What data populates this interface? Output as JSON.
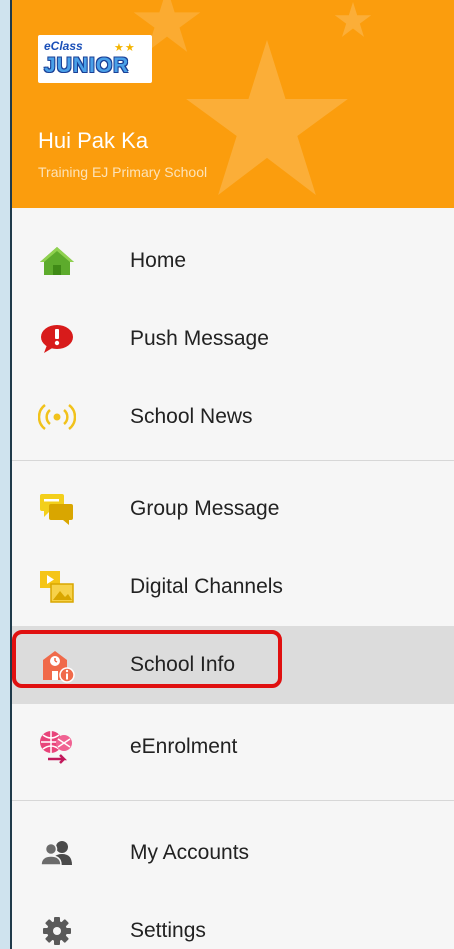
{
  "drawer": {
    "logo": {
      "eclass_text": "eClass",
      "junior_text": "JUNIOR"
    },
    "user_name": "Hui Pak Ka",
    "school_name": "Training EJ Primary School",
    "colors": {
      "header": "#fb9d0d",
      "selected_bg": "#dcdcdc",
      "highlight_border": "#e01010"
    }
  },
  "menu": {
    "items": [
      {
        "label": "Home",
        "icon": "home-icon"
      },
      {
        "label": "Push Message",
        "icon": "push-message-icon"
      },
      {
        "label": "School News",
        "icon": "broadcast-icon"
      },
      {
        "label": "Group Message",
        "icon": "chat-bubbles-icon"
      },
      {
        "label": "Digital Channels",
        "icon": "media-channels-icon"
      },
      {
        "label": "School Info",
        "icon": "school-info-icon",
        "selected": true
      },
      {
        "label": "eEnrolment",
        "icon": "enrolment-icon"
      }
    ],
    "secondary": [
      {
        "label": "My Accounts",
        "icon": "accounts-icon"
      },
      {
        "label": "Settings",
        "icon": "gear-icon"
      }
    ]
  }
}
